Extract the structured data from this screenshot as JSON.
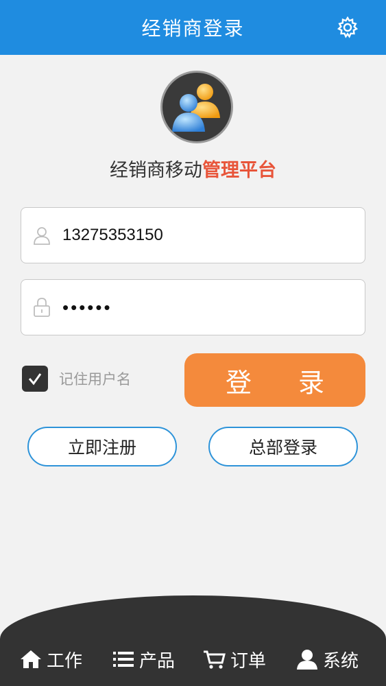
{
  "header": {
    "title": "经销商登录",
    "settings_icon": "gear-icon"
  },
  "brand": {
    "title_normal": "经销商移动",
    "title_highlight": "管理平台",
    "highlight_color": "#e8553a",
    "logo_icon": "users-icon"
  },
  "form": {
    "username": {
      "value": "13275353150",
      "icon": "user-icon"
    },
    "password": {
      "value": "••••••",
      "icon": "lock-icon"
    },
    "remember": {
      "label": "记住用户名",
      "checked": true
    },
    "login_label": "登 录",
    "register_label": "立即注册",
    "hq_login_label": "总部登录"
  },
  "nav": {
    "items": [
      {
        "label": "工作",
        "icon": "home-icon"
      },
      {
        "label": "产品",
        "icon": "list-icon"
      },
      {
        "label": "订单",
        "icon": "cart-icon"
      },
      {
        "label": "系统",
        "icon": "person-icon"
      }
    ]
  },
  "colors": {
    "header": "#1f8ce0",
    "login_button": "#f48a3c",
    "outline": "#2d93d9",
    "nav_bg": "#333333"
  }
}
